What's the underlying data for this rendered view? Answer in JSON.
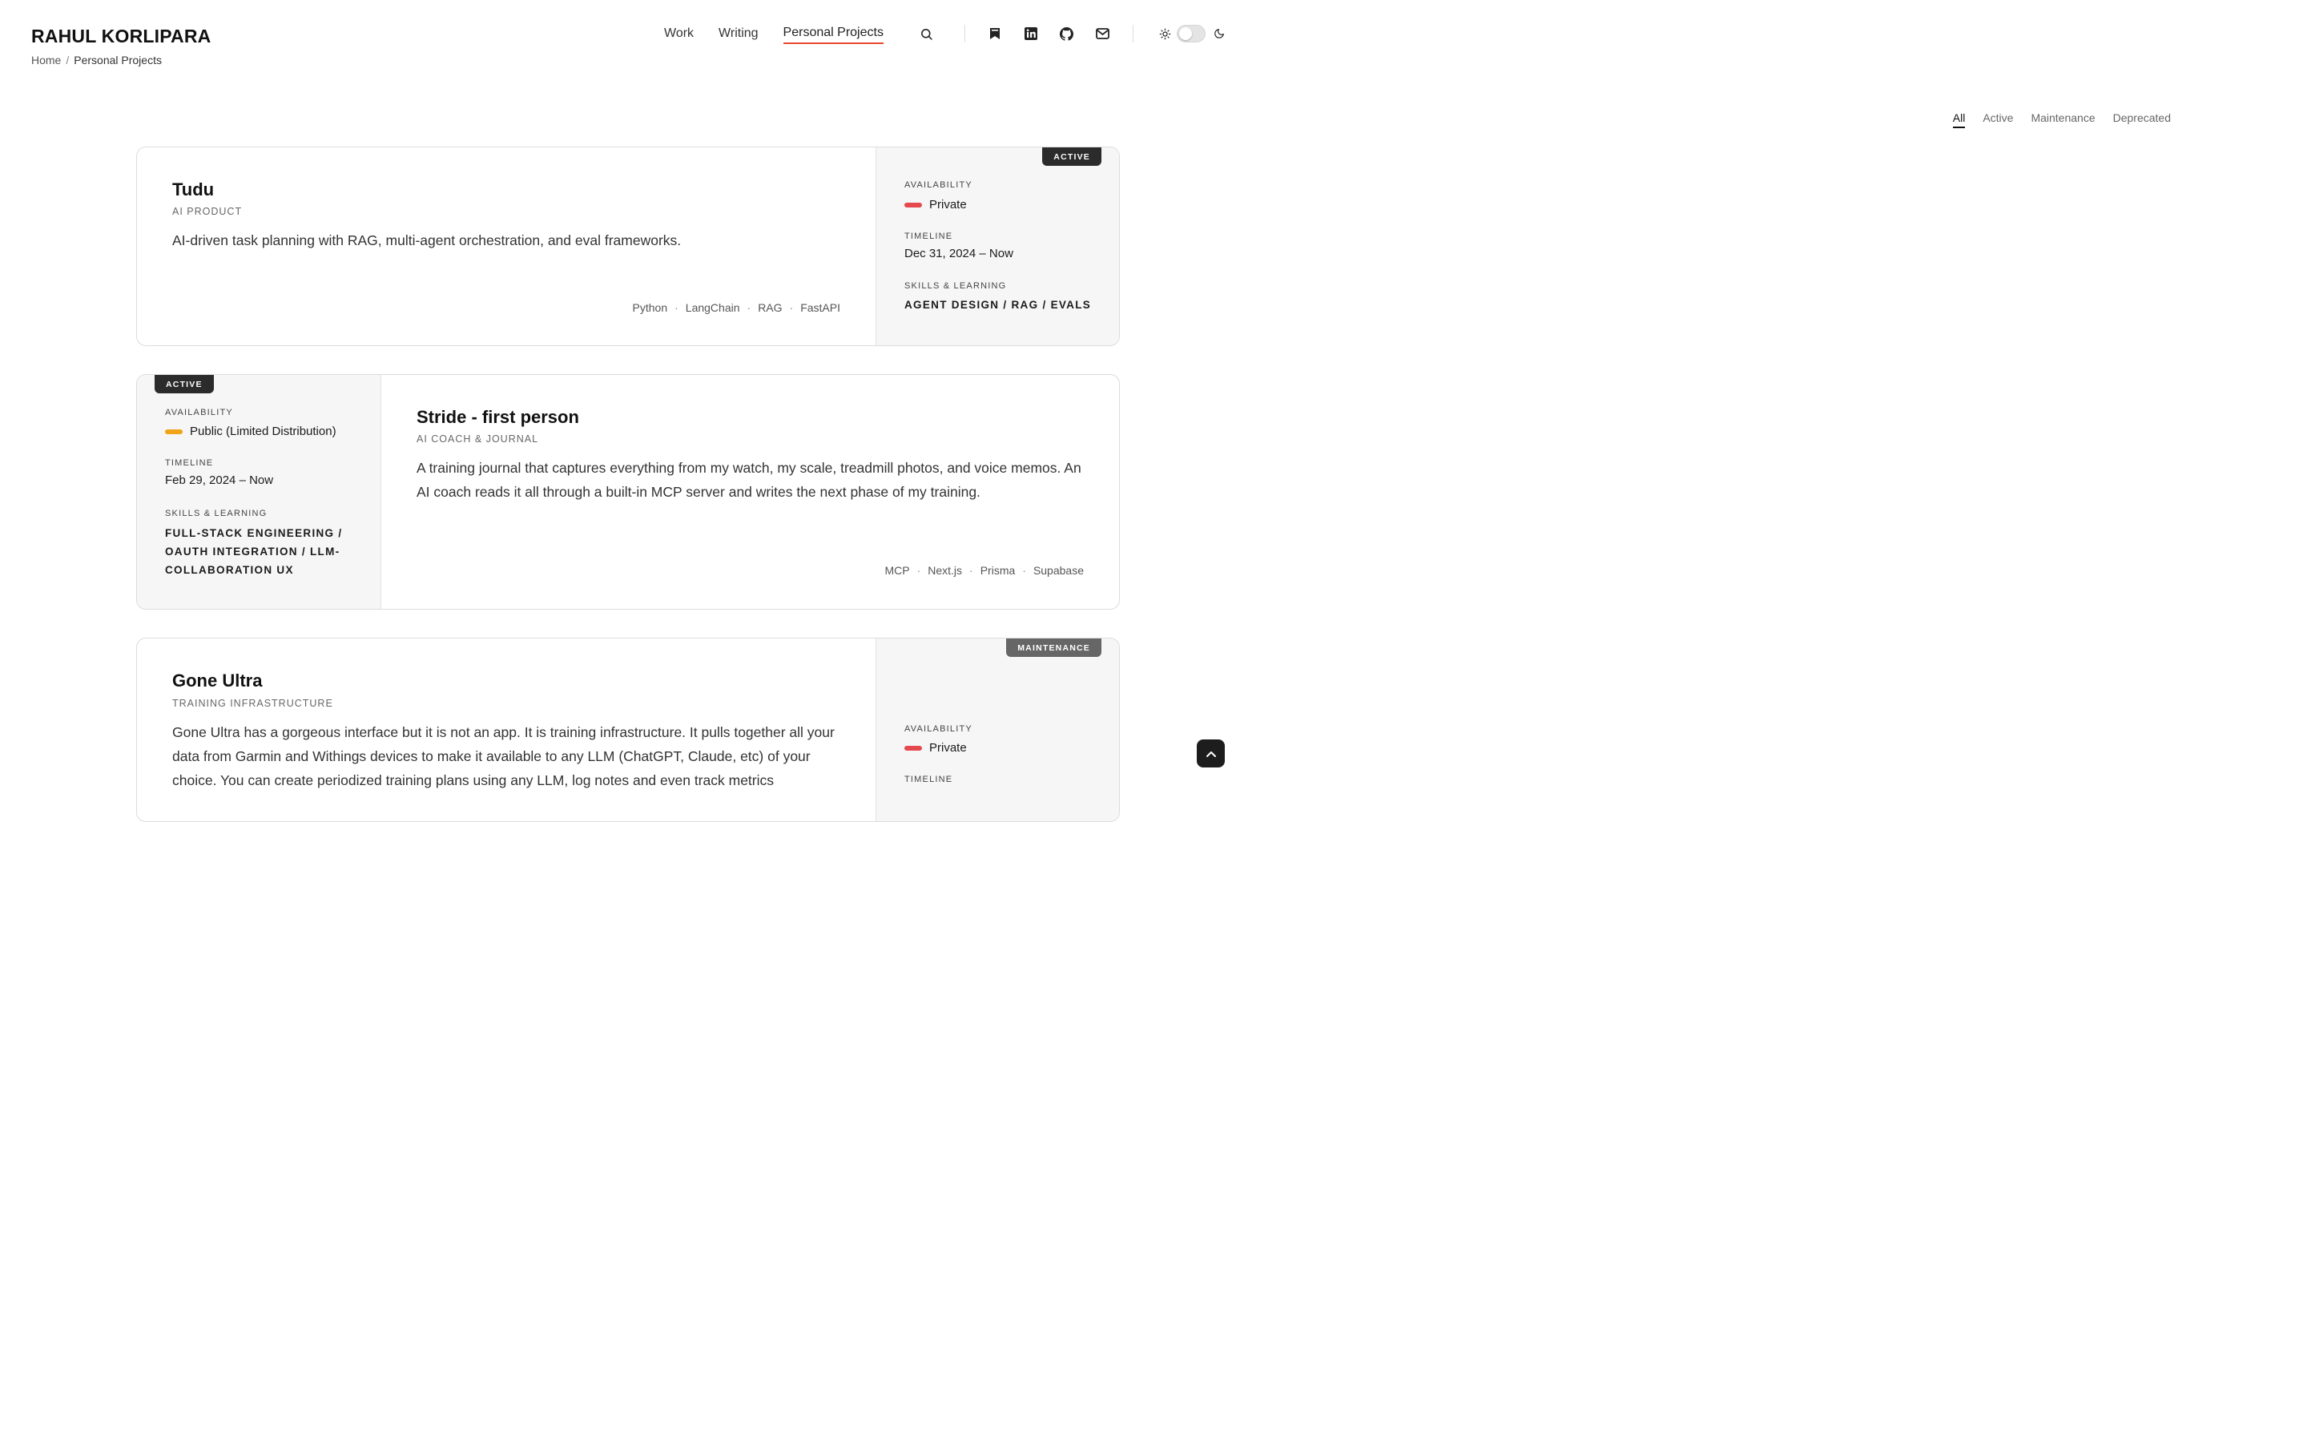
{
  "site": {
    "brand": "RAHUL KORLIPARA",
    "breadcrumb": {
      "home": "Home",
      "separator": "/",
      "current": "Personal Projects"
    },
    "nav": {
      "work": "Work",
      "writing": "Writing",
      "projects": "Personal Projects"
    },
    "icons": [
      "search-icon",
      "bookmark-icon",
      "linkedin-icon",
      "github-icon",
      "mail-icon",
      "sun-icon",
      "moon-icon"
    ],
    "accent_color": "#e8482f"
  },
  "filters": {
    "all": "All",
    "active": "Active",
    "maintenance": "Maintenance",
    "deprecated": "Deprecated",
    "selected": "All"
  },
  "labels": {
    "availability": "AVAILABILITY",
    "timeline": "TIMELINE",
    "skills": "SKILLS & LEARNING"
  },
  "projects": [
    {
      "title": "Tudu",
      "category": "AI PRODUCT",
      "description": "AI-driven task planning with RAG, multi-agent orchestration, and eval frameworks.",
      "tags": [
        "Python",
        "LangChain",
        "RAG",
        "FastAPI"
      ],
      "status": "ACTIVE",
      "availability": "Private",
      "availability_color": "#e5484d",
      "timeline": "Dec 31, 2024 – Now",
      "skills": "AGENT DESIGN / RAG / EVALS"
    },
    {
      "title": "Stride - first person",
      "category": "AI COACH & JOURNAL",
      "description": "A training journal that captures everything from my watch, my scale, treadmill photos, and voice memos. An AI coach reads it all through a built-in MCP server and writes the next phase of my training.",
      "tags": [
        "MCP",
        "Next.js",
        "Prisma",
        "Supabase"
      ],
      "status": "ACTIVE",
      "availability": "Public (Limited Distribution)",
      "availability_color": "#f0a417",
      "timeline": "Feb 29, 2024 – Now",
      "skills": "FULL-STACK ENGINEERING / OAUTH INTEGRATION / LLM-COLLABORATION UX"
    },
    {
      "title": "Gone Ultra",
      "category": "TRAINING INFRASTRUCTURE",
      "description": "Gone Ultra has a gorgeous interface but it is not an app. It is training infrastructure. It pulls together all your data from Garmin and Withings devices to make it available to any LLM (ChatGPT, Claude, etc) of your choice. You can create periodized training plans using any LLM, log notes and even track metrics",
      "status": "MAINTENANCE",
      "availability": "Private",
      "availability_color": "#e5484d",
      "timeline_label_only": true
    }
  ]
}
